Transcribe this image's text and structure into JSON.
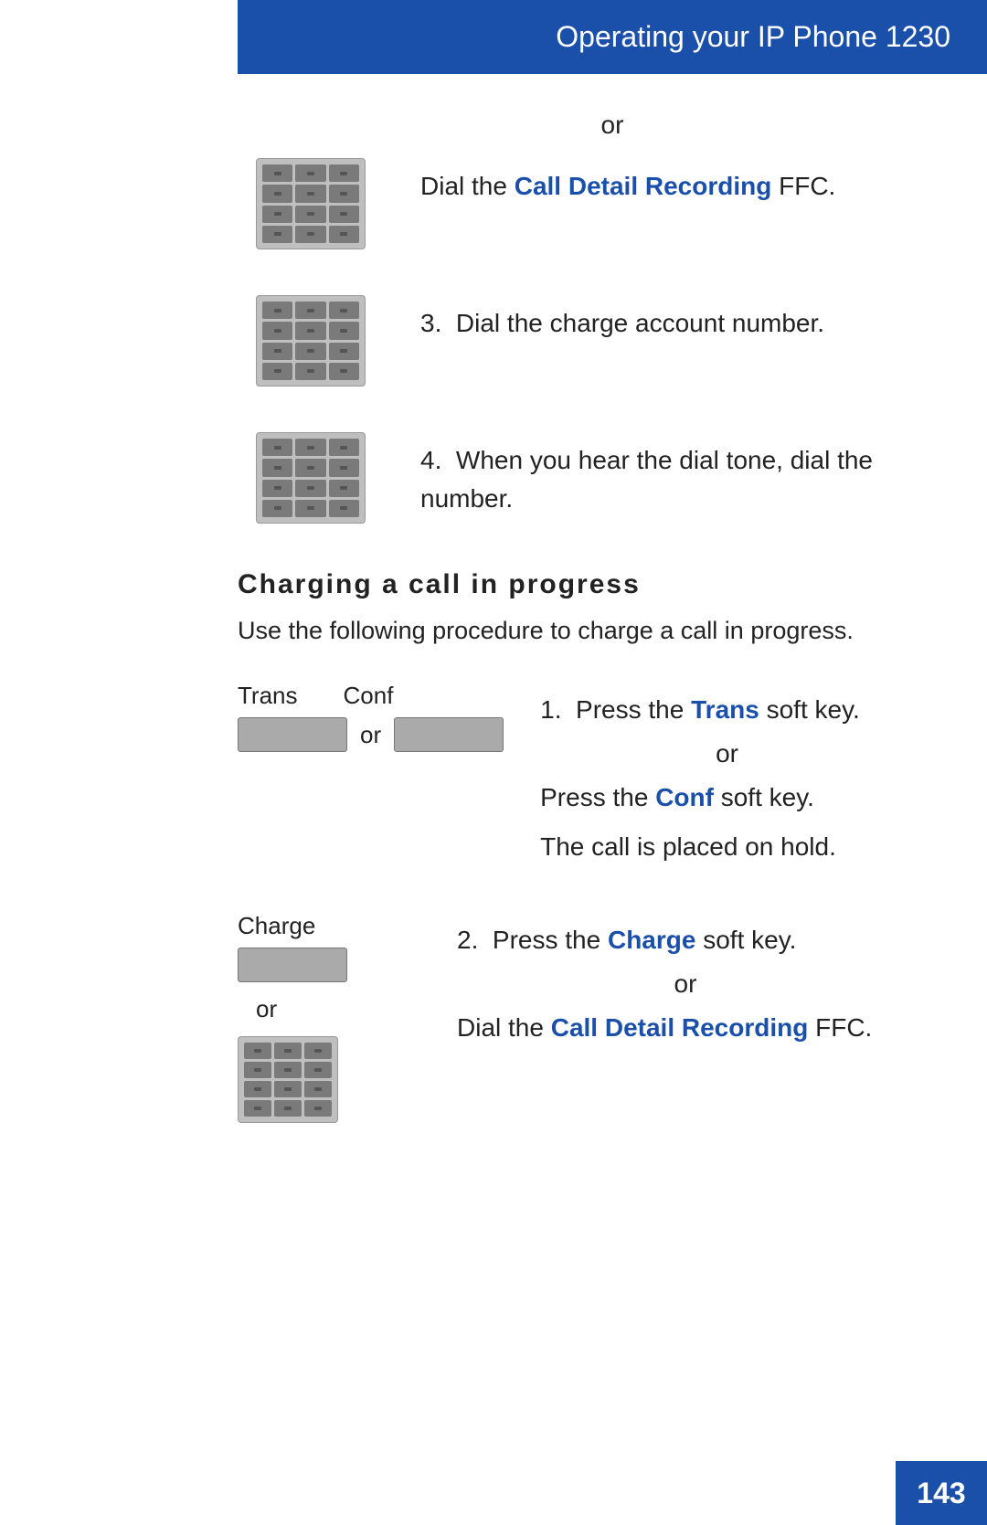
{
  "header": {
    "title": "Operating your IP Phone ",
    "title_num": "1230"
  },
  "top_or": "or",
  "rows": [
    {
      "id": "dial-cdr",
      "text_before_blue": "Dial the ",
      "blue_text": "Call Detail Recording",
      "text_after_blue": " FFC."
    },
    {
      "id": "step3",
      "step_num": "3.",
      "text": "Dial the charge account number."
    },
    {
      "id": "step4",
      "step_num": "4.",
      "text": "When you hear the dial tone, dial the number."
    }
  ],
  "section": {
    "heading": "Charging a call in progress",
    "intro": "Use the following procedure to charge a call in progress."
  },
  "trans_conf": {
    "trans_label": "Trans",
    "conf_label": "Conf",
    "or_text": "or",
    "step1_prefix": "Press the ",
    "step1_blue": "Trans",
    "step1_suffix": " soft key.",
    "or_inner": "or",
    "step1b_prefix": "Press the ",
    "step1b_blue": "Conf",
    "step1b_suffix": " soft key.",
    "hold_text": "The call is placed on hold."
  },
  "charge": {
    "charge_label": "Charge",
    "or_text": "or",
    "step2_prefix": "Press the ",
    "step2_blue": "Charge",
    "step2_suffix": " soft key.",
    "or_inner": "or",
    "step2b_prefix": "Dial the ",
    "step2b_blue": "Call Detail Recording",
    "step2b_suffix": " FFC."
  },
  "page_number": "143"
}
